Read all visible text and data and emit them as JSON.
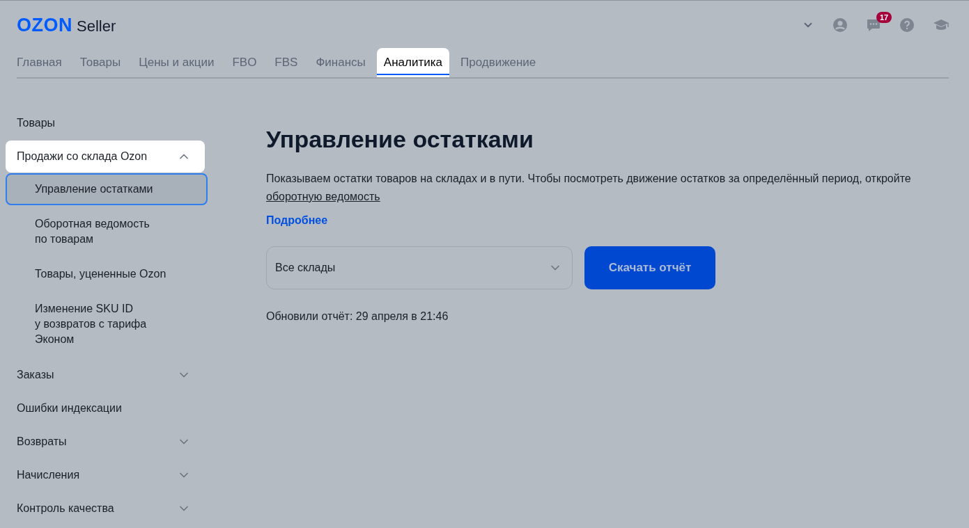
{
  "header": {
    "logo": "OZON",
    "logo_suffix": "Seller",
    "notifications_badge": "17"
  },
  "tabs": [
    {
      "label": "Главная",
      "selected": false
    },
    {
      "label": "Товары",
      "selected": false
    },
    {
      "label": "Цены и акции",
      "selected": false
    },
    {
      "label": "FBO",
      "selected": false
    },
    {
      "label": "FBS",
      "selected": false
    },
    {
      "label": "Финансы",
      "selected": false
    },
    {
      "label": "Аналитика",
      "selected": true
    },
    {
      "label": "Продвижение",
      "selected": false
    }
  ],
  "sidebar": {
    "items": [
      {
        "kind": "link",
        "label": "Товары",
        "highlighted": false
      },
      {
        "kind": "group",
        "label": "Продажи со склада Ozon",
        "highlighted": true,
        "expanded": true,
        "children": [
          {
            "label": "Управление остатками",
            "selected": true
          },
          {
            "label": "Оборотная ведомость\nпо товарам",
            "selected": false
          },
          {
            "label": "Товары, уцененные Ozon",
            "selected": false
          },
          {
            "label": "Изменение SKU ID\nу возвратов с тарифа\nЭконом",
            "selected": false
          }
        ]
      },
      {
        "kind": "group",
        "label": "Заказы",
        "highlighted": false,
        "expanded": false
      },
      {
        "kind": "link",
        "label": "Ошибки индексации",
        "highlighted": false
      },
      {
        "kind": "group",
        "label": "Возвраты",
        "highlighted": false,
        "expanded": false
      },
      {
        "kind": "group",
        "label": "Начисления",
        "highlighted": false,
        "expanded": false
      },
      {
        "kind": "group",
        "label": "Контроль качества",
        "highlighted": false,
        "expanded": false
      }
    ]
  },
  "main": {
    "title": "Управление остатками",
    "description": "Показываем остатки товаров на складах и в пути. Чтобы посмотреть движение остатков за определённый период, откройте ",
    "description_link": "оборотную ведомость",
    "more_link": "Подробнее",
    "warehouse_select": {
      "value": "Все склады"
    },
    "download_button": "Скачать отчёт",
    "updated": "Обновили отчёт: 29 апреля в 21:46"
  }
}
